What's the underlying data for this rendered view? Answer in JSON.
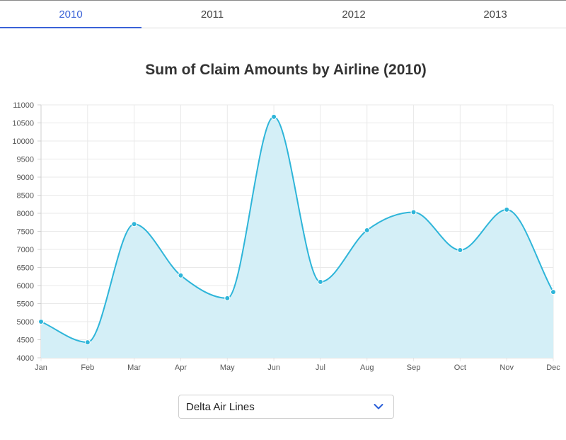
{
  "tabs": [
    {
      "label": "2010",
      "active": true
    },
    {
      "label": "2011",
      "active": false
    },
    {
      "label": "2012",
      "active": false
    },
    {
      "label": "2013",
      "active": false
    }
  ],
  "dropdown": {
    "selected": "Delta Air Lines",
    "icon": "chevron-down-icon"
  },
  "colors": {
    "accent": "#3a62d7",
    "line": "#2eb5d9",
    "fill": "#d4eff7",
    "grid": "#e9e9e9"
  },
  "chart_data": {
    "type": "area",
    "title": "Sum of Claim Amounts by Airline (2010)",
    "categories": [
      "Jan",
      "Feb",
      "Mar",
      "Apr",
      "May",
      "Jun",
      "Jul",
      "Aug",
      "Sep",
      "Oct",
      "Nov",
      "Dec"
    ],
    "values": [
      5000,
      4430,
      7700,
      6280,
      5650,
      10670,
      6100,
      7530,
      8030,
      6980,
      8100,
      5820
    ],
    "ylim": [
      4000,
      11000
    ],
    "ytick_step": 500,
    "yticks": [
      "4000",
      "4500",
      "5000",
      "5500",
      "6000",
      "6500",
      "7000",
      "7500",
      "8000",
      "8500",
      "9000",
      "9500",
      "10000",
      "10500",
      "11000"
    ],
    "grid": true,
    "smooth": true,
    "xlabel": "",
    "ylabel": ""
  }
}
